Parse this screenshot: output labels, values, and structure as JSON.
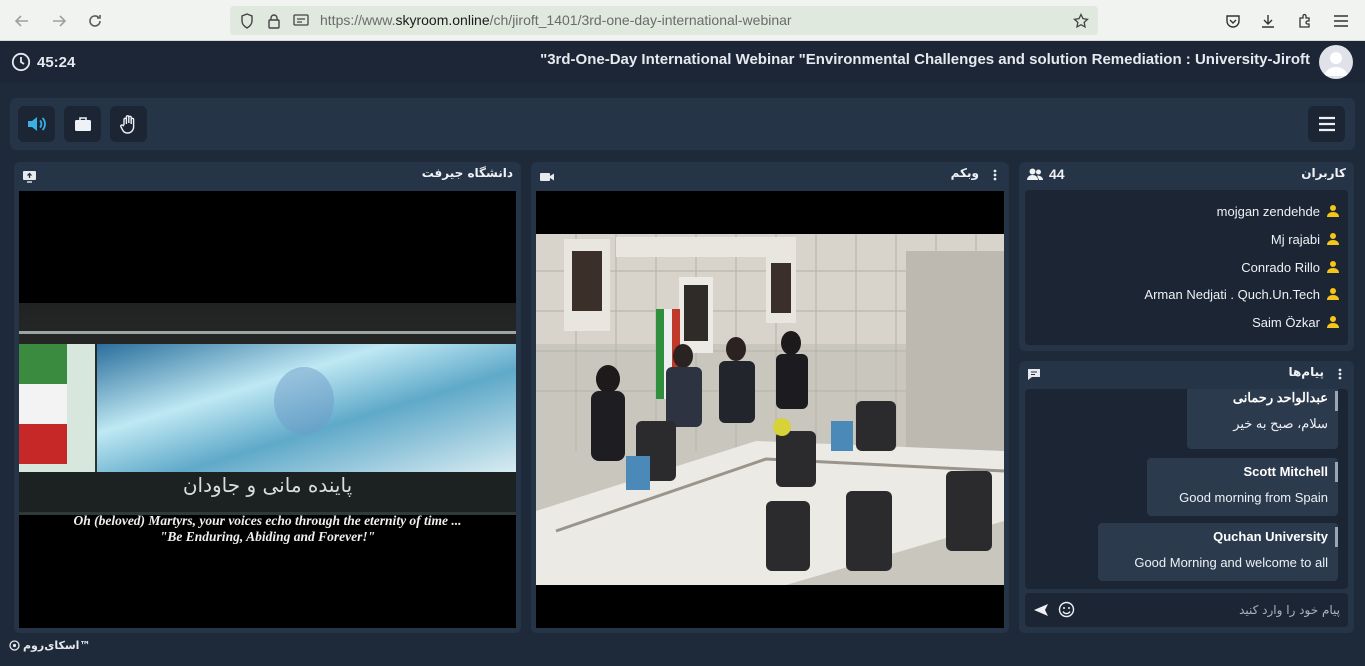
{
  "browser": {
    "url_prefix": "https://www.",
    "url_domain": "skyroom.online",
    "url_path": "/ch/jiroft_1401/3rd-one-day-international-webinar"
  },
  "header": {
    "timer": "45:24",
    "title": "\"3rd-One-Day International Webinar \"Environmental Challenges and solution Remediation : University-Jiroft"
  },
  "panels": {
    "screen": {
      "title": "دانشگاه جیرفت"
    },
    "webcam": {
      "title": "وبکم"
    },
    "users": {
      "title": "کاربران",
      "count": "44"
    },
    "messages": {
      "title": "پیام‌ها"
    }
  },
  "video_caption": {
    "persian": "پاینده مانی و جاودان",
    "english_line1": "Oh (beloved) Martyrs, your voices echo through the eternity of time ...",
    "english_line2": "\"Be Enduring, Abiding and Forever!\""
  },
  "users": [
    {
      "name": "mojgan zendehde"
    },
    {
      "name": "Mj rajabi"
    },
    {
      "name": "Conrado Rillo"
    },
    {
      "name": "Arman Nedjati . Quch.Un.Tech"
    },
    {
      "name": "Saim Özkar"
    }
  ],
  "messages": [
    {
      "author": "عبدالواحد رحمانی",
      "text": "سلام، صبح به خیر"
    },
    {
      "author": "Scott Mitchell",
      "text": "Good morning from Spain"
    },
    {
      "author": "Quchan University",
      "text": "Good Morning and welcome to all"
    }
  ],
  "chat_input": {
    "placeholder": "پیام خود را وارد کنید"
  },
  "footer": {
    "brand": "اسکای‌روم™"
  },
  "colors": {
    "accent": "#3ab0e5",
    "user_icon": "#f5c518",
    "panel": "#263447",
    "background": "#1e2a3a"
  }
}
